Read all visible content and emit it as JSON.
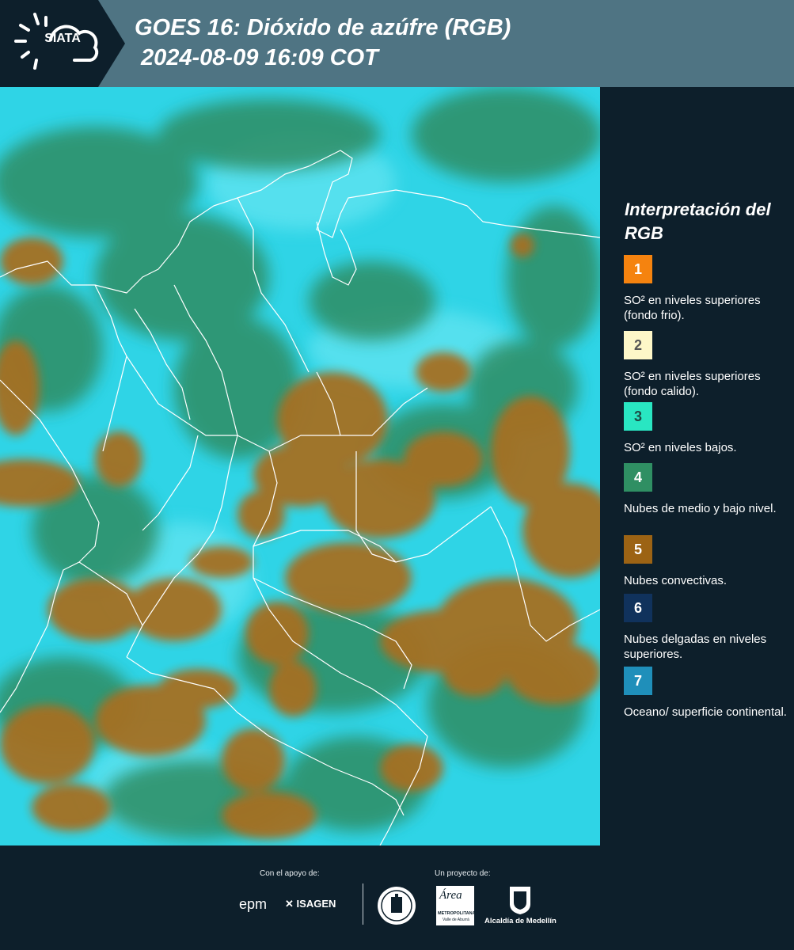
{
  "header": {
    "logo_text": "SIATA",
    "title_line1": "GOES 16: Dióxido de azúfre (RGB)",
    "title_line2": "2024-08-09 16:09 COT"
  },
  "legend": {
    "title": "Interpretación del RGB",
    "items": [
      {
        "number": "1",
        "label": "SO² en niveles superiores (fondo frio).",
        "color": "#f5830f",
        "text_color": "#ffffff"
      },
      {
        "number": "2",
        "label": "SO² en niveles superiores (fondo calido).",
        "color": "#fdf7c8",
        "text_color": "#555555"
      },
      {
        "number": "3",
        "label": "SO² en niveles bajos.",
        "color": "#29e6c2",
        "text_color": "#1d4a45"
      },
      {
        "number": "4",
        "label": "Nubes de medio y bajo nivel.",
        "color": "#2f8f63",
        "text_color": "#ffffff"
      },
      {
        "number": "5",
        "label": "Nubes convectivas.",
        "color": "#9c6314",
        "text_color": "#ffffff"
      },
      {
        "number": "6",
        "label": "Nubes delgadas en niveles superiores.",
        "color": "#10325c",
        "text_color": "#ffffff"
      },
      {
        "number": "7",
        "label": "Oceano/ superficie continental.",
        "color": "#1f8fba",
        "text_color": "#ffffff"
      }
    ]
  },
  "map": {
    "colors": {
      "background": "#2fd4e6",
      "clear": "#5fe3f0",
      "green_clouds": "#2f8d63",
      "convective": "#a56f22",
      "boundaries": "#ffffff"
    }
  },
  "footer": {
    "support_caption": "Con el apoyo de:",
    "project_caption": "Un proyecto de:",
    "sponsor_epm": "epm",
    "sponsor_isagen": "ISAGEN",
    "metropolitana_text": "Área",
    "metropolitana_sub": "METROPOLITANA",
    "metropolitana_sub2": "Valle de Aburrá",
    "alcaldia": "Alcaldía de Medellín"
  }
}
